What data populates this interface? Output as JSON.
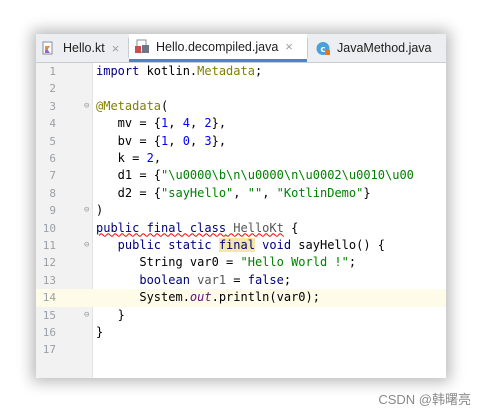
{
  "tabs": [
    {
      "label": "Hello.kt",
      "icon": "kotlin-file-icon",
      "active": false
    },
    {
      "label": "Hello.decompiled.java",
      "icon": "java-decompiled-file-icon",
      "active": true
    },
    {
      "label": "JavaMethod.java",
      "icon": "java-class-icon",
      "active": false
    }
  ],
  "close_glyph": "×",
  "line_numbers": [
    "1",
    "2",
    "3",
    "4",
    "5",
    "6",
    "7",
    "8",
    "9",
    "10",
    "11",
    "12",
    "13",
    "14",
    "15",
    "16",
    "17"
  ],
  "code": {
    "l1_kw": "import",
    "l1_rest": " kotlin.",
    "l1_cls": "Metadata",
    "l1_end": ";",
    "l3_ann": "@Metadata",
    "l3_paren": "(",
    "l4_a": "   mv = {",
    "l4_n1": "1",
    "l4_c1": ", ",
    "l4_n2": "4",
    "l4_c2": ", ",
    "l4_n3": "2",
    "l4_end": "},",
    "l5_a": "   bv = {",
    "l5_n1": "1",
    "l5_c1": ", ",
    "l5_n2": "0",
    "l5_c2": ", ",
    "l5_n3": "3",
    "l5_end": "},",
    "l6_a": "   k = ",
    "l6_n": "2",
    "l6_end": ",",
    "l7_a": "   d1 = {",
    "l7_str": "\"\\u0000\\b\\n\\u0000\\n\\u0002\\u0010\\u00",
    "l8_a": "   d2 = {",
    "l8_s1": "\"sayHello\"",
    "l8_c1": ", ",
    "l8_s2": "\"\"",
    "l8_c2": ", ",
    "l8_s3": "\"KotlinDemo\"",
    "l8_end": "}",
    "l9": ")",
    "l10_kw": "public final class",
    "l10_cls": " HelloKt",
    "l10_end": " {",
    "l11_kw1": "   public static ",
    "l11_final": "final",
    "l11_kw2": " void",
    "l11_rest": " sayHello() {",
    "l12_a": "      String var0 = ",
    "l12_str": "\"Hello World !\"",
    "l12_end": ";",
    "l13_kw": "      boolean",
    "l13_var": " var1",
    "l13_mid": " = ",
    "l13_val": "false",
    "l13_end": ";",
    "l14_a": "      System.",
    "l14_out": "out",
    "l14_rest": ".println(var0);",
    "l15": "   }",
    "l16": "}"
  },
  "watermark": "CSDN @韩曙亮",
  "colors": {
    "keyword": "#000080",
    "annotation": "#808000",
    "string": "#008000",
    "number": "#0000ff",
    "static_field": "#660e7a",
    "tab_underline": "#4a86c7"
  }
}
